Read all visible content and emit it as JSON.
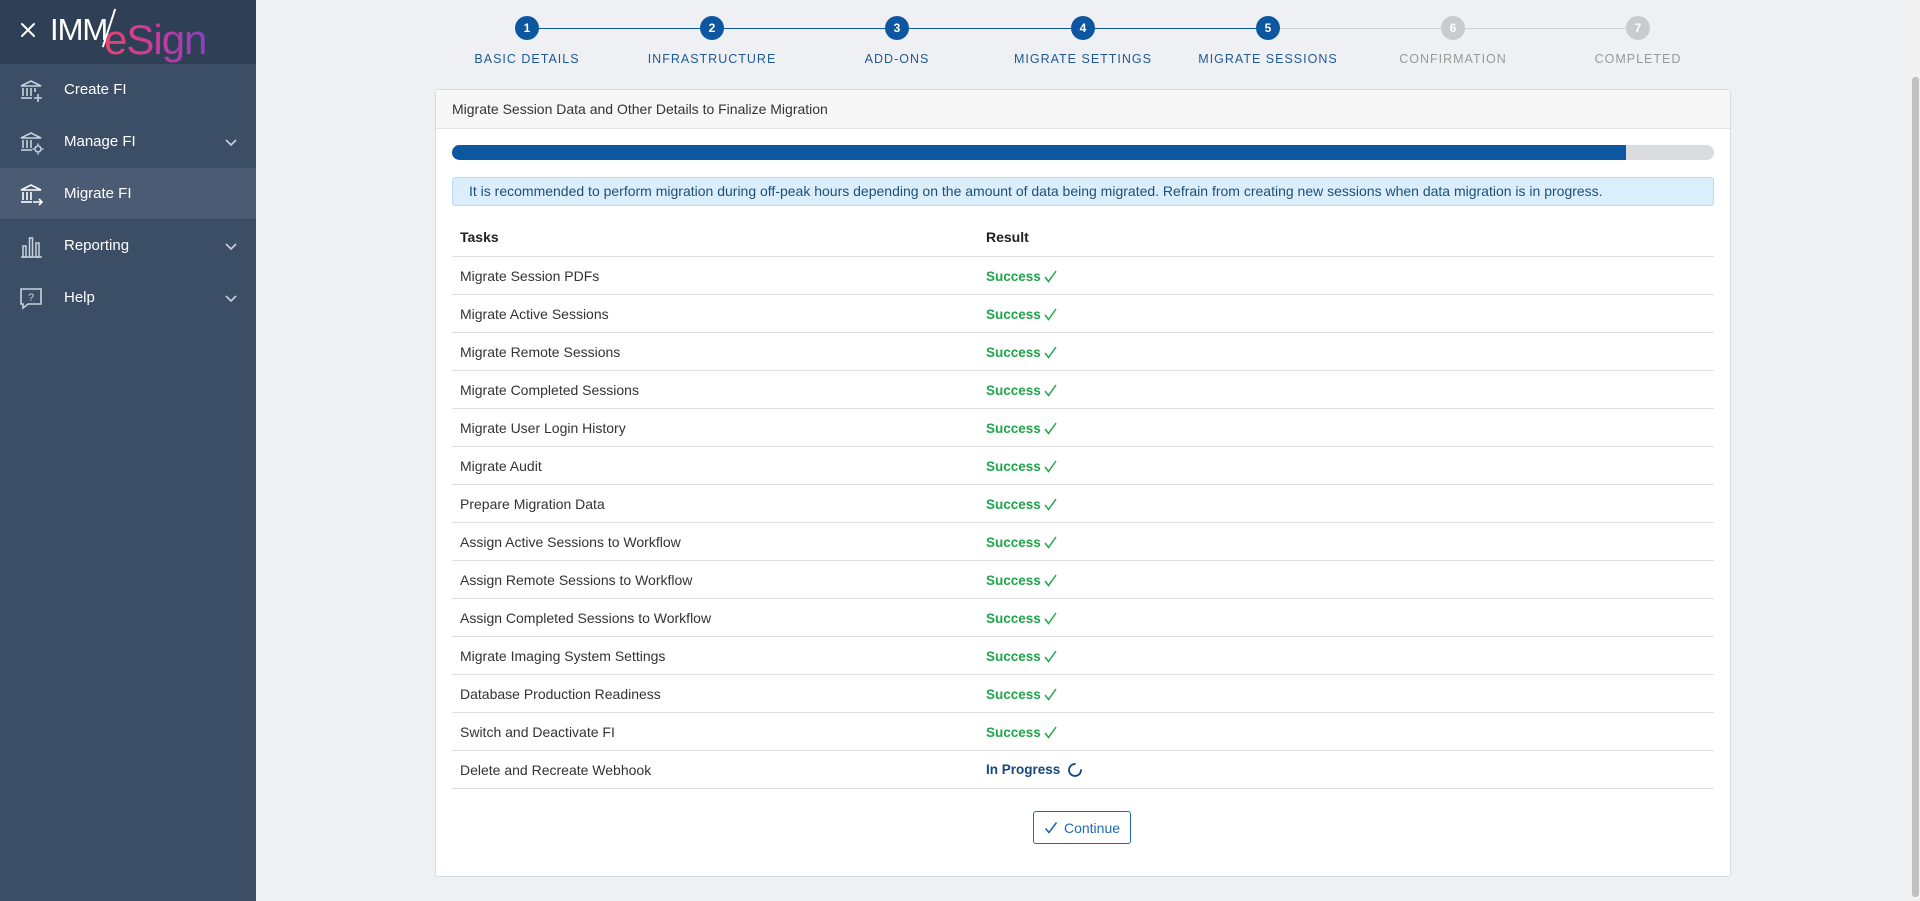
{
  "sidebar": {
    "logo": {
      "left": "IMM",
      "right": "eSign"
    },
    "items": [
      {
        "label": "Create FI",
        "icon": "bank-plus-icon",
        "expandable": false,
        "active": false
      },
      {
        "label": "Manage FI",
        "icon": "bank-gear-icon",
        "expandable": true,
        "active": false
      },
      {
        "label": "Migrate FI",
        "icon": "bank-arrow-icon",
        "expandable": false,
        "active": true
      },
      {
        "label": "Reporting",
        "icon": "bar-chart-icon",
        "expandable": true,
        "active": false
      },
      {
        "label": "Help",
        "icon": "help-bubble-icon",
        "expandable": true,
        "active": false
      }
    ]
  },
  "stepper": {
    "steps": [
      {
        "number": "1",
        "label": "BASIC DETAILS",
        "state": "done"
      },
      {
        "number": "2",
        "label": "INFRASTRUCTURE",
        "state": "done"
      },
      {
        "number": "3",
        "label": "ADD-ONS",
        "state": "done"
      },
      {
        "number": "4",
        "label": "MIGRATE SETTINGS",
        "state": "done"
      },
      {
        "number": "5",
        "label": "MIGRATE SESSIONS",
        "state": "done"
      },
      {
        "number": "6",
        "label": "CONFIRMATION",
        "state": "todo"
      },
      {
        "number": "7",
        "label": "COMPLETED",
        "state": "todo"
      }
    ]
  },
  "card": {
    "title": "Migrate Session Data and Other Details to Finalize Migration",
    "progress_fraction": 0.93,
    "alert": "It is recommended to perform migration during off-peak hours depending on the amount of data being migrated. Refrain from creating new sessions when data migration is in progress.",
    "table": {
      "headers": {
        "task": "Tasks",
        "result": "Result"
      },
      "rows": [
        {
          "task": "Migrate Session PDFs",
          "result": "Success",
          "status": "success"
        },
        {
          "task": "Migrate Active Sessions",
          "result": "Success",
          "status": "success"
        },
        {
          "task": "Migrate Remote Sessions",
          "result": "Success",
          "status": "success"
        },
        {
          "task": "Migrate Completed Sessions",
          "result": "Success",
          "status": "success"
        },
        {
          "task": "Migrate User Login History",
          "result": "Success",
          "status": "success"
        },
        {
          "task": "Migrate Audit",
          "result": "Success",
          "status": "success"
        },
        {
          "task": "Prepare Migration Data",
          "result": "Success",
          "status": "success"
        },
        {
          "task": "Assign Active Sessions to Workflow",
          "result": "Success",
          "status": "success"
        },
        {
          "task": "Assign Remote Sessions to Workflow",
          "result": "Success",
          "status": "success"
        },
        {
          "task": "Assign Completed Sessions to Workflow",
          "result": "Success",
          "status": "success"
        },
        {
          "task": "Migrate Imaging System Settings",
          "result": "Success",
          "status": "success"
        },
        {
          "task": "Database Production Readiness",
          "result": "Success",
          "status": "success"
        },
        {
          "task": "Switch and Deactivate FI",
          "result": "Success",
          "status": "success"
        },
        {
          "task": "Delete and Recreate Webhook",
          "result": "In Progress",
          "status": "in-progress"
        }
      ]
    },
    "continue_label": "Continue"
  },
  "colors": {
    "sidebar_bg": "#3c4e66",
    "sidebar_active": "#4a5b73",
    "primary": "#0d57a0",
    "success": "#1fa64a",
    "in_progress": "#15467e"
  }
}
